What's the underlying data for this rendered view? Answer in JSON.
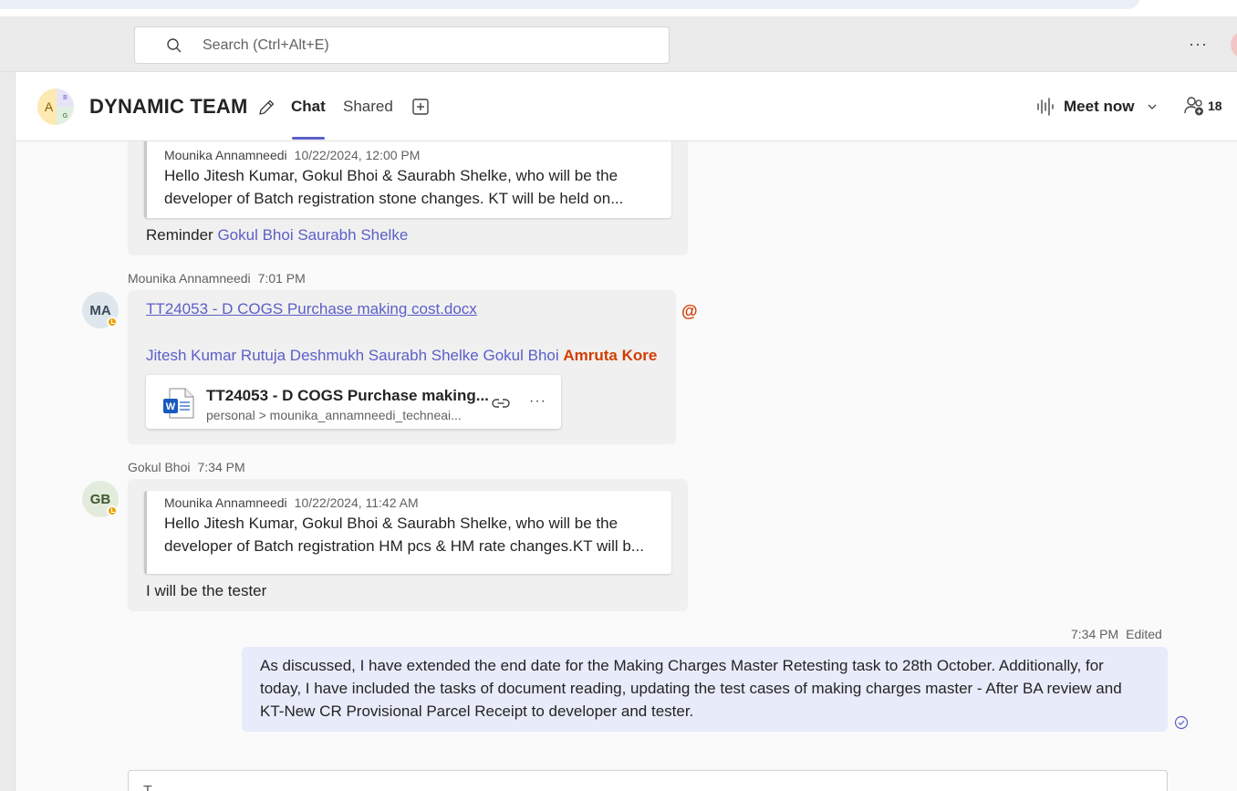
{
  "search": {
    "placeholder": "Search (Ctrl+Alt+E)"
  },
  "topbar": {
    "more_label": "···"
  },
  "header": {
    "group_avatar": {
      "a": "A",
      "b": "B",
      "g": "G"
    },
    "title": "DYNAMIC TEAM",
    "tabs": [
      {
        "label": "Chat",
        "active": true
      },
      {
        "label": "Shared",
        "active": false
      }
    ],
    "meet_now": "Meet now",
    "participant_count": "18"
  },
  "messages": [
    {
      "quote": {
        "author": "Mounika Annamneedi",
        "time": "10/22/2024, 12:00 PM",
        "line1": "Hello Jitesh Kumar, Gokul Bhoi & Saurabh Shelke, who will be the",
        "line2": "developer of Batch registration stone changes. KT will be held on..."
      },
      "text_prefix": "Reminder",
      "mentions": "Gokul Bhoi Saurabh Shelke"
    },
    {
      "author": "Mounika Annamneedi",
      "time": "7:01 PM",
      "initials": "MA",
      "file_link": "TT24053 - D COGS Purchase making cost.docx",
      "mentions": "Jitesh Kumar Rutuja Deshmukh Saurabh Shelke Gokul Bhoi",
      "mention_me": "Amruta Kore",
      "at_symbol": "@",
      "file_card": {
        "name": "TT24053 - D COGS Purchase making...",
        "path": "personal > mounika_annamneedi_techneai...",
        "more": "···"
      }
    },
    {
      "author": "Gokul Bhoi",
      "time": "7:34 PM",
      "initials": "GB",
      "quote": {
        "author": "Mounika Annamneedi",
        "time": "10/22/2024, 11:42 AM",
        "line1": "Hello Jitesh Kumar, Gokul Bhoi & Saurabh Shelke, who will be the",
        "line2": "developer of Batch registration HM pcs & HM rate changes.KT will b..."
      },
      "text": "I will be the tester"
    },
    {
      "time": "7:34 PM",
      "edited": "Edited",
      "line1": "As discussed, I have extended the end date for the Making Charges Master Retesting task to 28th October. Additionally, for",
      "line2": "today, I have included the tasks of document reading, updating the test cases of making charges master - After BA review and",
      "line3": "KT-New CR Provisional Parcel Receipt to developer and tester."
    }
  ],
  "compose": {
    "placeholder": "T"
  },
  "colors": {
    "accent": "#5b5fc7",
    "mention_me": "#d13d00",
    "my_bubble": "#e8ebfa",
    "presence_away": "#eaa300"
  },
  "icons": [
    "search-icon",
    "more-icon",
    "pencil-icon",
    "add-tab-icon",
    "meet-wave-icon",
    "chevron-down-icon",
    "participants-icon",
    "word-file-icon",
    "link-icon",
    "read-receipt-icon",
    "at-icon"
  ]
}
